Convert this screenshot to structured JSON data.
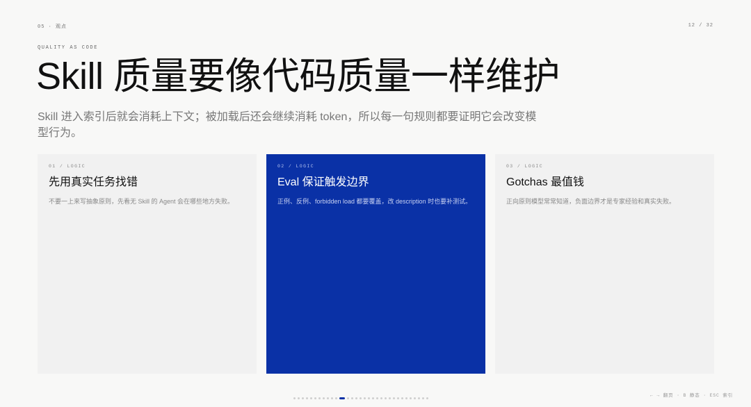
{
  "header": {
    "section": "05 · 观点",
    "page_indicator": "12 / 32"
  },
  "eyebrow": "QUALITY AS CODE",
  "title": "Skill 质量要像代码质量一样维护",
  "subtitle": "Skill 进入索引后就会消耗上下文；被加载后还会继续消耗 token，所以每一句规则都要证明它会改变模型行为。",
  "cards": [
    {
      "tag": "01 / LOGIC",
      "title": "先用真实任务找错",
      "body": "不要一上来写抽象原则，先看无 Skill 的 Agent 会在哪些地方失败。"
    },
    {
      "tag": "02 / LOGIC",
      "title": "Eval 保证触发边界",
      "body": "正例、反例、forbidden load 都要覆盖，改 description 时也要补测试。"
    },
    {
      "tag": "03 / LOGIC",
      "title": "Gotchas 最值钱",
      "body": "正向原则模型常常知道，负面边界才是专家经验和真实失败。"
    }
  ],
  "pagination": {
    "total": 32,
    "current": 12
  },
  "nav_hint": "← → 翻页 · B 静态 · ESC 索引",
  "colors": {
    "accent": "#0a31a6",
    "background": "#f8f8f7",
    "card": "#f1f1f1"
  }
}
